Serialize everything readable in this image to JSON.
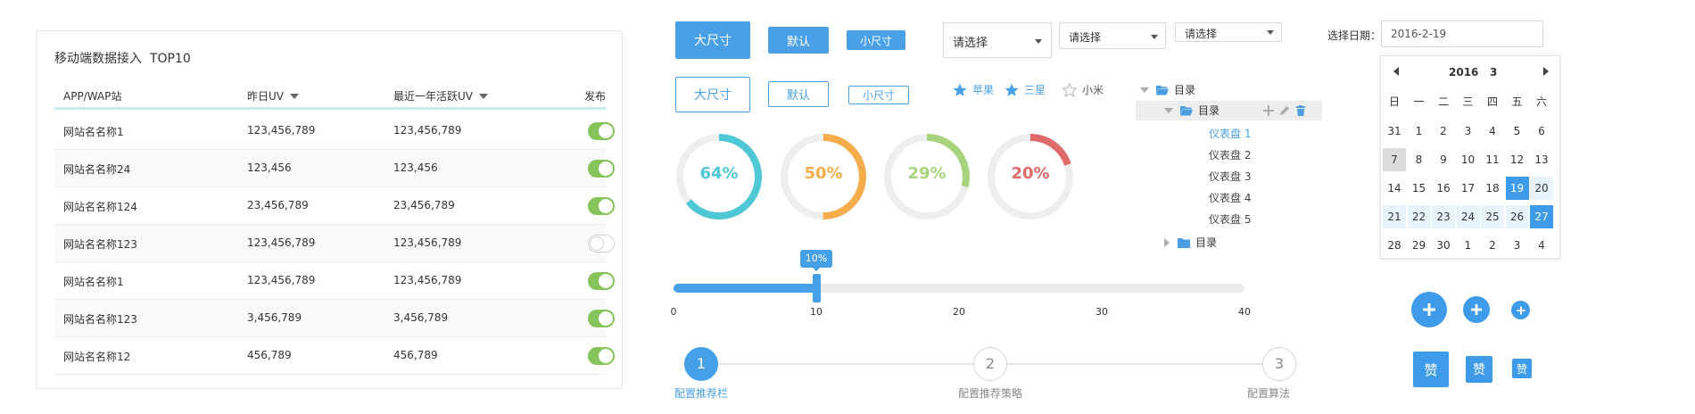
{
  "table_card": {
    "title": "移动端数据接入  TOP10",
    "columns": {
      "site": "APP/WAP站",
      "yesterday_uv": "昨日UV",
      "year_active_uv": "最近一年活跃UV",
      "publish": "发布"
    },
    "rows": [
      {
        "site": "网站名名称1",
        "yesterday_uv": "123,456,789",
        "year_active_uv": "123,456,789",
        "published": true
      },
      {
        "site": "网站名名称24",
        "yesterday_uv": "123,456",
        "year_active_uv": "123,456",
        "published": true
      },
      {
        "site": "网站名名称124",
        "yesterday_uv": "23,456,789",
        "year_active_uv": "23,456,789",
        "published": true
      },
      {
        "site": "网站名名称123",
        "yesterday_uv": "123,456,789",
        "year_active_uv": "123,456,789",
        "published": false
      },
      {
        "site": "网站名名称1",
        "yesterday_uv": "123,456,789",
        "year_active_uv": "123,456,789",
        "published": true
      },
      {
        "site": "网站名名称123",
        "yesterday_uv": "3,456,789",
        "year_active_uv": "3,456,789",
        "published": true
      },
      {
        "site": "网站名名称12",
        "yesterday_uv": "456,789",
        "year_active_uv": "456,789",
        "published": true
      }
    ],
    "toggle_on_color": "#84c45a"
  },
  "buttons": {
    "solid": {
      "large": "大尺寸",
      "default": "默认",
      "small": "小尺寸"
    },
    "outline": {
      "large": "大尺寸",
      "default": "默认",
      "small": "小尺寸"
    },
    "accent_color": "#49a0e6"
  },
  "selects": {
    "large": "请选择",
    "default": "请选择",
    "small": "请选择"
  },
  "date_picker": {
    "label": "选择日期：",
    "value": "2016-2-19",
    "year": "2016",
    "month": "3",
    "weekdays": [
      "日",
      "一",
      "二",
      "三",
      "四",
      "五",
      "六"
    ],
    "days": [
      [
        "31",
        "1",
        "2",
        "3",
        "4",
        "5",
        "6"
      ],
      [
        "7",
        "8",
        "9",
        "10",
        "11",
        "12",
        "13"
      ],
      [
        "14",
        "15",
        "16",
        "17",
        "18",
        "19",
        "20"
      ],
      [
        "21",
        "22",
        "23",
        "24",
        "25",
        "26",
        "27"
      ],
      [
        "28",
        "29",
        "30",
        "1",
        "2",
        "3",
        "4"
      ]
    ],
    "today": "7",
    "range_start": "19",
    "range_end": "27",
    "selected_color": "#3d9be9"
  },
  "rating": {
    "items": [
      {
        "label": "苹果",
        "filled": true
      },
      {
        "label": "三星",
        "filled": true
      },
      {
        "label": "小米",
        "filled": false
      }
    ],
    "filled_color": "#49a0e6"
  },
  "progress_rings": [
    {
      "label": "64%",
      "value": 0.64,
      "color": "#4fc8d6"
    },
    {
      "label": "50%",
      "value": 0.5,
      "color": "#f5ad4c"
    },
    {
      "label": "29%",
      "value": 0.29,
      "color": "#a6d37b"
    },
    {
      "label": "20%",
      "value": 0.2,
      "color": "#e06a6a"
    }
  ],
  "slider": {
    "tooltip": "10%",
    "value": 10,
    "min": 0,
    "max": 40,
    "ticks": [
      "0",
      "10",
      "20",
      "30",
      "40"
    ]
  },
  "steps": [
    {
      "number": "1",
      "label": "配置推荐栏",
      "active": true
    },
    {
      "number": "2",
      "label": "配置推荐策略",
      "active": false
    },
    {
      "number": "3",
      "label": "配置算法",
      "active": false
    }
  ],
  "tree": {
    "root_label": "目录",
    "child_label": "目录",
    "leaves": [
      "仪表盘 1",
      "仪表盘 2",
      "仪表盘 3",
      "仪表盘 4",
      "仪表盘 5"
    ],
    "collapsed_label": "目录"
  },
  "circle_buttons": {
    "icon": "plus-icon"
  },
  "like_buttons": {
    "label": "赞"
  }
}
